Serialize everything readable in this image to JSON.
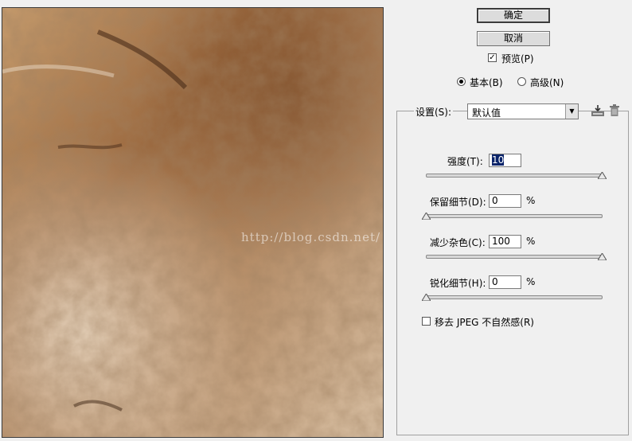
{
  "buttons": {
    "ok_label": "确定",
    "cancel_label": "取消"
  },
  "preview_checkbox": {
    "label": "预览(P)",
    "checked": true
  },
  "mode": {
    "basic_label": "基本(B)",
    "advanced_label": "高级(N)",
    "selected": "basic"
  },
  "settings": {
    "label": "设置(S):",
    "selected_value": "默认值"
  },
  "controls": [
    {
      "label": "强度(T):",
      "value": "10",
      "unit": "",
      "slider_fraction": 1.0
    },
    {
      "label": "保留细节(D):",
      "value": "0",
      "unit": "%",
      "slider_fraction": 0.0
    },
    {
      "label": "减少杂色(C):",
      "value": "100",
      "unit": "%",
      "slider_fraction": 1.0
    },
    {
      "label": "锐化细节(H):",
      "value": "0",
      "unit": "%",
      "slider_fraction": 0.0
    }
  ],
  "jpeg_checkbox": {
    "label": "移去 JPEG 不自然感(R)",
    "checked": false
  },
  "watermark": "http://blog.csdn.net/",
  "colors": {
    "dialog_bg": "#f0f0f0",
    "selection": "#0a246a",
    "stone": "#a87a52"
  }
}
